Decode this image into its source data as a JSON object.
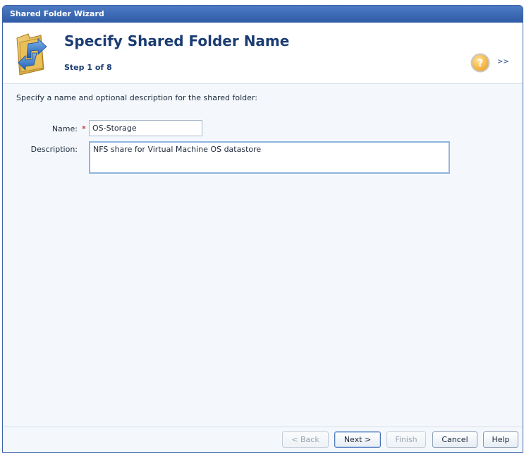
{
  "window": {
    "title": "Shared Folder Wizard"
  },
  "header": {
    "title": "Specify Shared Folder Name",
    "step": "Step 1 of 8",
    "expand": ">>",
    "icon": "shared-folder-icon",
    "help_icon": "question-icon"
  },
  "form": {
    "instruction": "Specify a name and optional description for the shared folder:",
    "name_label": "Name:",
    "required_mark": "*",
    "name_value": "OS-Storage",
    "description_label": "Description:",
    "description_value": "NFS share for Virtual Machine OS datastore"
  },
  "footer": {
    "back": "< Back",
    "next": "Next >",
    "finish": "Finish",
    "cancel": "Cancel",
    "help": "Help"
  },
  "colors": {
    "titlebar": "#2f5ba5",
    "heading": "#1b3c73",
    "required": "#d23c3c",
    "focus_border": "#8fb5df"
  }
}
